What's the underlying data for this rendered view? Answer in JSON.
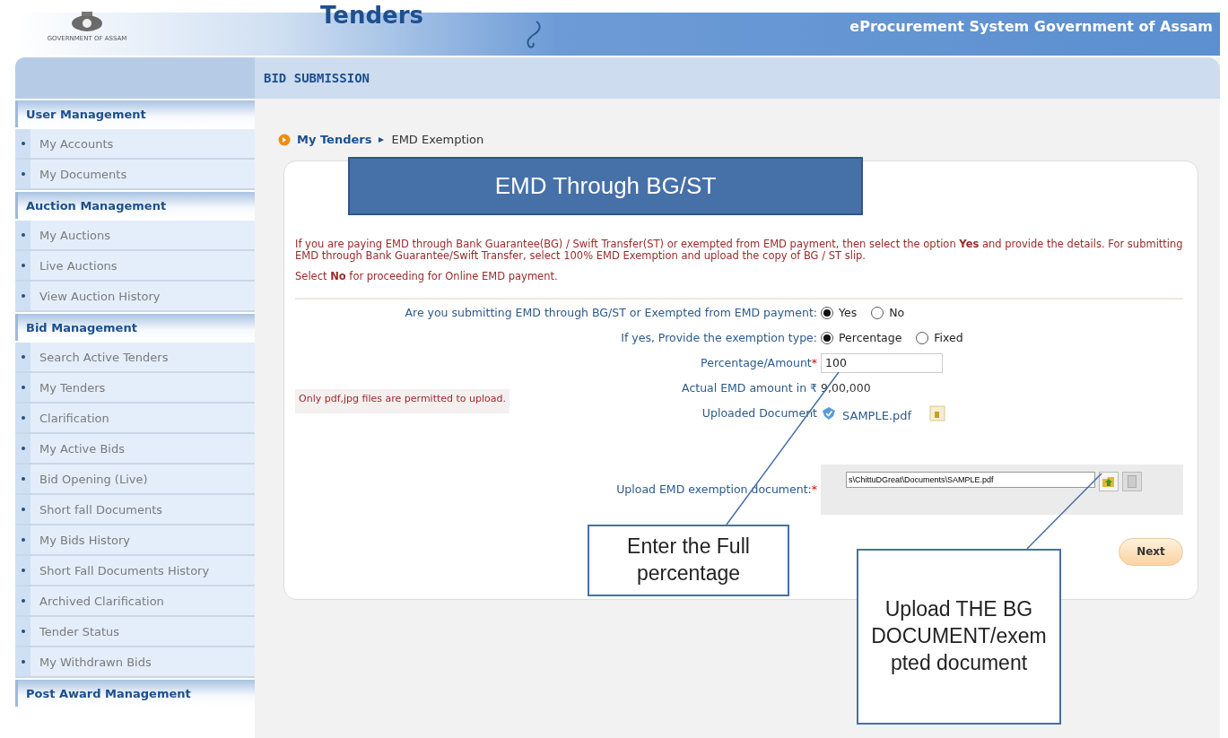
{
  "header": {
    "brand": "Tenders",
    "emblem_caption": "GOVERNMENT OF ASSAM",
    "site_title": "eProcurement System Government of Assam"
  },
  "sidebar": {
    "sections": [
      {
        "title": "User Management",
        "items": [
          "My Accounts",
          "My Documents"
        ]
      },
      {
        "title": "Auction Management",
        "items": [
          "My Auctions",
          "Live Auctions",
          "View Auction History"
        ]
      },
      {
        "title": "Bid Management",
        "items": [
          "Search Active Tenders",
          "My Tenders",
          "Clarification",
          "My Active Bids",
          "Bid Opening (Live)",
          "Short fall Documents",
          "My Bids History",
          "Short Fall Documents History",
          "Archived Clarification",
          "Tender Status",
          "My Withdrawn Bids"
        ]
      },
      {
        "title": "Post Award Management"
      }
    ]
  },
  "page_title": "BID SUBMISSION",
  "breadcrumb": {
    "parent": "My Tenders",
    "current": "EMD Exemption"
  },
  "notice": [
    "If you are paying EMD through Bank Guarantee(BG) / Swift Transfer(ST) or exempted from EMD payment, then select the option **Yes** and provide the details. For submitting EMD through Bank Guarantee/Swift Transfer, select 100% EMD Exemption and upload the copy of BG / ST slip.",
    "Select **No** for proceeding for Online EMD payment."
  ],
  "file_note": "Only pdf,jpg files are permitted to upload.",
  "form": [
    {
      "kind": "radio",
      "label": "Are you submitting EMD through BG/ST or Exempted from EMD payment:",
      "options": [
        {
          "label": "Yes",
          "selected": true
        },
        {
          "label": "No",
          "selected": false
        }
      ]
    },
    {
      "kind": "radio",
      "label": "If yes, Provide the exemption type:",
      "options": [
        {
          "label": "Percentage",
          "selected": true
        },
        {
          "label": "Fixed",
          "selected": false
        }
      ]
    },
    {
      "kind": "text",
      "label": "Percentage/Amount",
      "required_mark": "*",
      "value": "100"
    },
    {
      "kind": "static",
      "label": "Actual EMD amount in ₹",
      "value": "9,00,000"
    },
    {
      "kind": "link",
      "label": "Uploaded Document",
      "value": "SAMPLE.pdf"
    },
    {
      "kind": "file",
      "label": "Upload EMD exemption document:",
      "required_mark": "*",
      "value": "s\\ChittuDGreat\\Documents\\SAMPLE.pdf"
    }
  ],
  "next_button": "Next",
  "callouts": [
    {
      "kind": "banner",
      "text": "EMD Through BG/ST"
    },
    {
      "kind": "note",
      "text": "Enter the Full percentage"
    },
    {
      "kind": "note",
      "text": "Upload THE BG DOCUMENT/exempted document"
    }
  ]
}
